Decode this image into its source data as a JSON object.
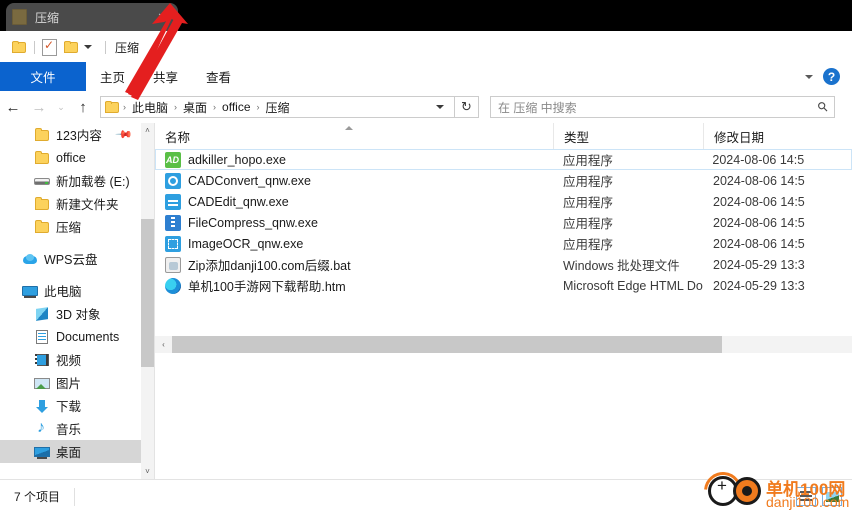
{
  "tab": {
    "title": "压缩",
    "close_label": "✕",
    "icon": "folder-icon"
  },
  "titlebar": {
    "quick_access": {
      "folder_icon": "folder-icon",
      "properties_icon": "properties-checkbox-icon",
      "new_folder_icon": "new-folder-icon",
      "customize_icon": "chevron-down-icon"
    },
    "window_title": "压缩",
    "minimize_label": "",
    "maximize_label": "",
    "close_label": "✕"
  },
  "ribbon": {
    "tabs": [
      {
        "label": "文件",
        "active": true
      },
      {
        "label": "主页",
        "active": false
      },
      {
        "label": "共享",
        "active": false
      },
      {
        "label": "查看",
        "active": false
      }
    ],
    "expand_icon": "chevron-down-icon",
    "help_label": "?"
  },
  "navbar": {
    "back_icon": "←",
    "forward_icon": "→",
    "recent_icon": "⌄",
    "up_icon": "↑",
    "breadcrumbs": [
      "此电脑",
      "桌面",
      "office",
      "压缩"
    ],
    "crumb_separator": "›",
    "dropdown_icon": "chevron-down-icon",
    "refresh_icon": "↻",
    "search_placeholder": "在 压缩 中搜索",
    "search_icon": "search-icon"
  },
  "navpane": {
    "items": [
      {
        "label": "123内容",
        "icon": "folder-icon",
        "indent": 2,
        "pinned": true,
        "selected": false
      },
      {
        "label": "office",
        "icon": "folder-icon",
        "indent": 2,
        "pinned": false,
        "selected": false
      },
      {
        "label": "新加载卷 (E:)",
        "icon": "drive-icon",
        "indent": 2,
        "pinned": false,
        "selected": false
      },
      {
        "label": "新建文件夹",
        "icon": "folder-icon",
        "indent": 2,
        "pinned": false,
        "selected": false
      },
      {
        "label": "压缩",
        "icon": "folder-icon",
        "indent": 2,
        "pinned": false,
        "selected": false
      },
      {
        "label": "WPS云盘",
        "icon": "cloud-icon",
        "indent": 1,
        "pinned": false,
        "selected": false,
        "gap_before": true
      },
      {
        "label": "此电脑",
        "icon": "computer-icon",
        "indent": 1,
        "pinned": false,
        "selected": false,
        "gap_before": true
      },
      {
        "label": "3D 对象",
        "icon": "3d-objects-icon",
        "indent": 2,
        "pinned": false,
        "selected": false
      },
      {
        "label": "Documents",
        "icon": "documents-icon",
        "indent": 2,
        "pinned": false,
        "selected": false
      },
      {
        "label": "视频",
        "icon": "videos-icon",
        "indent": 2,
        "pinned": false,
        "selected": false
      },
      {
        "label": "图片",
        "icon": "pictures-icon",
        "indent": 2,
        "pinned": false,
        "selected": false
      },
      {
        "label": "下载",
        "icon": "downloads-icon",
        "indent": 2,
        "pinned": false,
        "selected": false
      },
      {
        "label": "音乐",
        "icon": "music-icon",
        "indent": 2,
        "pinned": false,
        "selected": false
      },
      {
        "label": "桌面",
        "icon": "desktop-icon",
        "indent": 2,
        "pinned": false,
        "selected": true
      }
    ],
    "scroll_up_icon": "˄",
    "scroll_down_icon": "˅"
  },
  "filelist": {
    "columns": [
      "名称",
      "类型",
      "修改日期"
    ],
    "sort_column": "名称",
    "sort_direction": "ascending",
    "rows": [
      {
        "name": "adkiller_hopo.exe",
        "icon": "adkiller-app-icon",
        "type": "应用程序",
        "date": "2024-08-06 14:5",
        "focused": true
      },
      {
        "name": "CADConvert_qnw.exe",
        "icon": "cadconvert-app-icon",
        "type": "应用程序",
        "date": "2024-08-06 14:5",
        "focused": false
      },
      {
        "name": "CADEdit_qnw.exe",
        "icon": "cadedit-app-icon",
        "type": "应用程序",
        "date": "2024-08-06 14:5",
        "focused": false
      },
      {
        "name": "FileCompress_qnw.exe",
        "icon": "filecompress-app-icon",
        "type": "应用程序",
        "date": "2024-08-06 14:5",
        "focused": false
      },
      {
        "name": "ImageOCR_qnw.exe",
        "icon": "imageocr-app-icon",
        "type": "应用程序",
        "date": "2024-08-06 14:5",
        "focused": false
      },
      {
        "name": "Zip添加danji100.com后缀.bat",
        "icon": "bat-file-icon",
        "type": "Windows 批处理文件",
        "date": "2024-05-29 13:3",
        "focused": false
      },
      {
        "name": "单机100手游网下载帮助.htm",
        "icon": "edge-html-icon",
        "type": "Microsoft Edge HTML Doc...",
        "date": "2024-05-29 13:3",
        "focused": false
      }
    ],
    "hscroll_left_icon": "‹",
    "hscroll_right_icon": "›"
  },
  "statusbar": {
    "item_count": "7 个项目",
    "view_details_icon": "details-view-icon",
    "view_large_icon": "large-icons-view-icon"
  },
  "watermark": {
    "cn_text": "单机100网",
    "en_text": "danji100.com",
    "accent_color": "#f07b1e"
  },
  "annotation": {
    "arrow_color": "#e41f1f",
    "arrow_description": "red-arrow-pointing-to-tab"
  },
  "colors": {
    "ribbon_file_tab": "#0b63ce",
    "selection": "#d6d6d6",
    "focus_outline": "#cce4f7",
    "tab_strip": "#000000",
    "tab_bg": "#4a4a4a"
  }
}
